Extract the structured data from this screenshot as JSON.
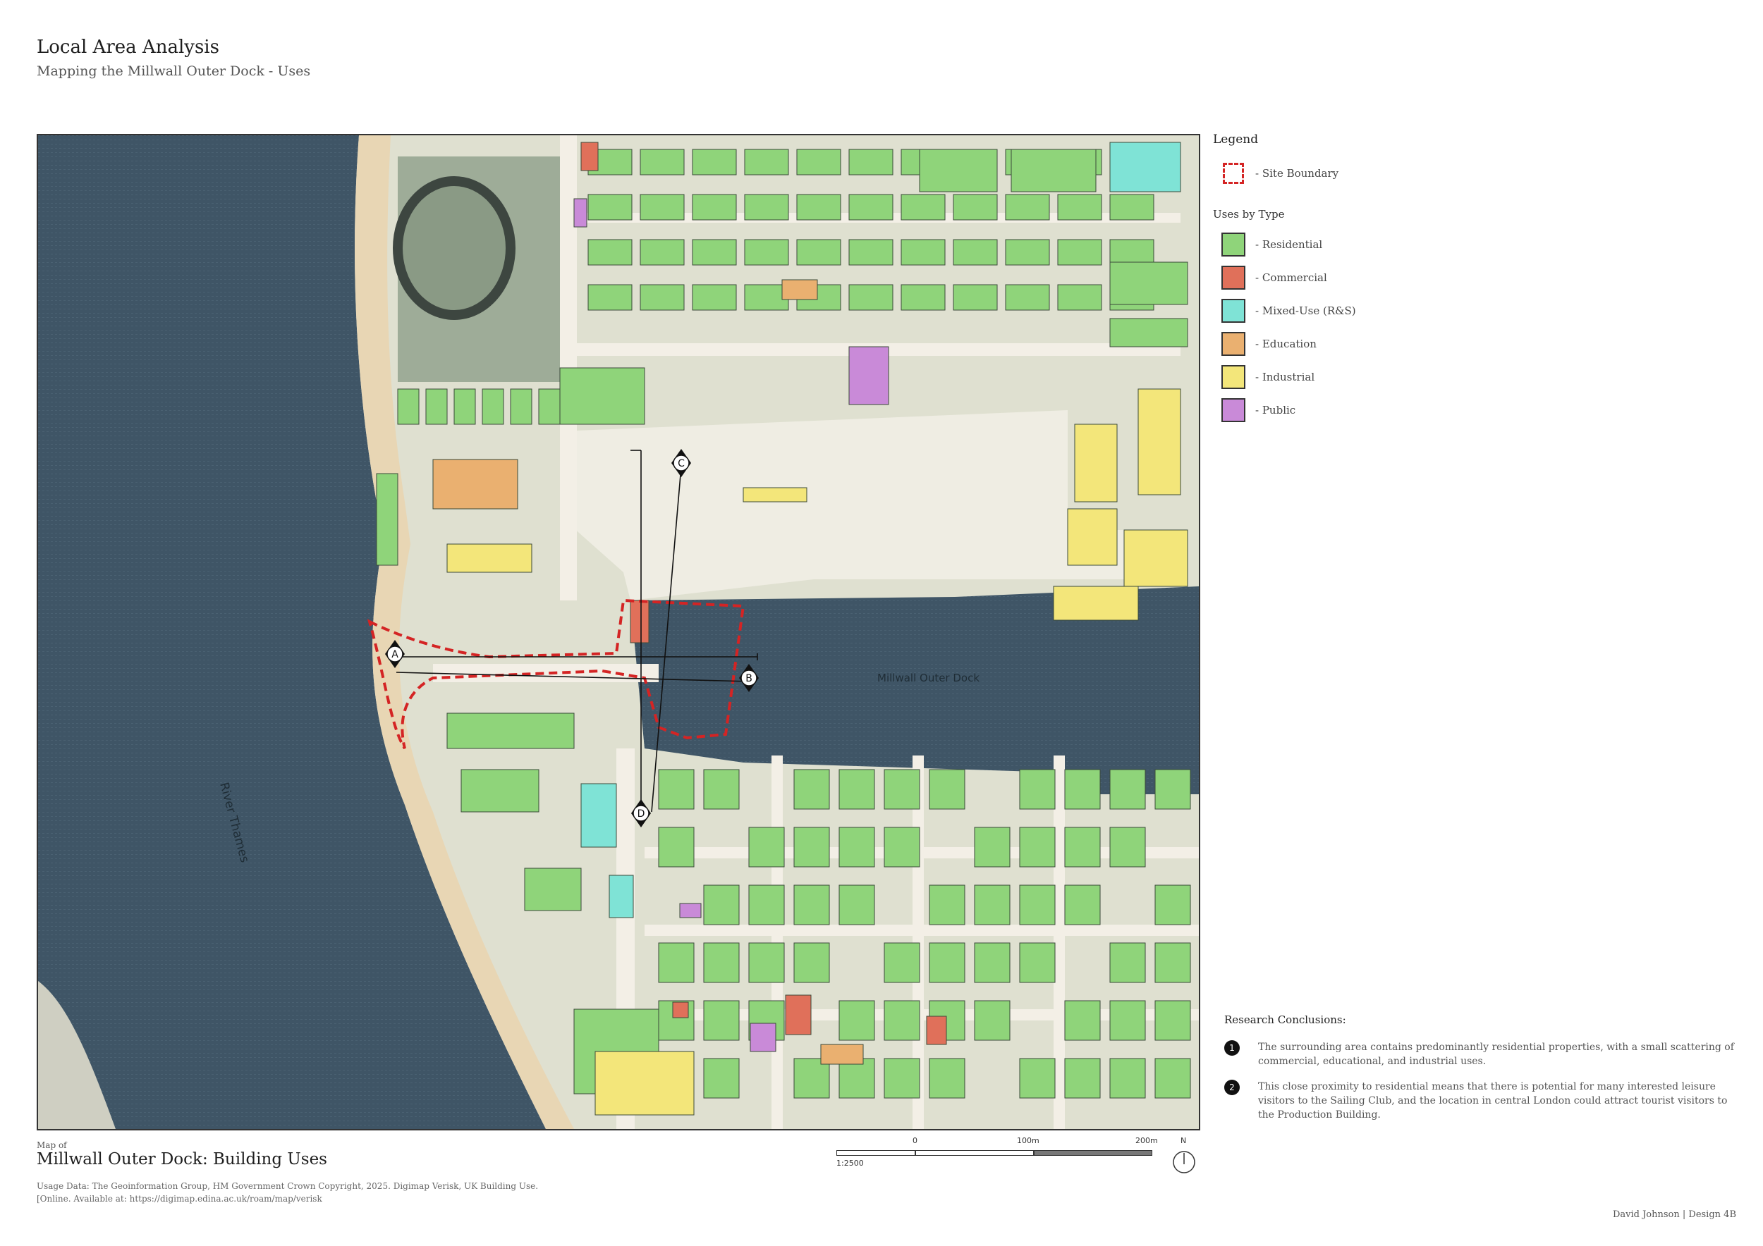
{
  "header": {
    "title": "Local Area Analysis",
    "subtitle": "Mapping the Millwall Outer Dock - Uses"
  },
  "map": {
    "labels": {
      "dock": "Millwall Outer Dock",
      "river": "River Thames",
      "marker_a": "A",
      "marker_b": "B",
      "marker_c": "C",
      "marker_d": "D"
    },
    "colors": {
      "water": "#3f5566",
      "beach": "#e8d6b4",
      "ground": "#e4e2d2",
      "park": "#9eac98",
      "road": "#f3efe6",
      "plaza": "#efede3",
      "residential": "#8fd47a",
      "commercial": "#e0705a",
      "mixed_use": "#7fe3d6",
      "education": "#eab070",
      "industrial": "#f3e67a",
      "public": "#c98ad8",
      "site_boundary": "#d42424"
    }
  },
  "legend": {
    "title": "Legend",
    "site_boundary": "- Site Boundary",
    "uses_title": "Uses by Type",
    "items": [
      {
        "label": "- Residential",
        "color": "#8fd47a"
      },
      {
        "label": "- Commercial",
        "color": "#e0705a"
      },
      {
        "label": "- Mixed-Use (R&S)",
        "color": "#7fe3d6"
      },
      {
        "label": "- Education",
        "color": "#eab070"
      },
      {
        "label": "- Industrial",
        "color": "#f3e67a"
      },
      {
        "label": "- Public",
        "color": "#c98ad8"
      }
    ]
  },
  "conclusions": {
    "title": "Research Conclusions:",
    "items": [
      {
        "num": "1",
        "text": "The surrounding area contains predominantly residential properties, with a small scattering of commercial, educational, and industrial uses."
      },
      {
        "num": "2",
        "text": "This close proximity to residential means that there is potential for many interested leisure visitors to the Sailing Club, and the location in central London could attract tourist visitors to the Production Building."
      }
    ]
  },
  "footer": {
    "map_of": "Map of",
    "map_title": "Millwall Outer Dock: Building Uses",
    "usage_line1": "Usage Data: The Geoinformation Group, HM Government Crown Copyright, 2025. Digimap Verisk, UK Building Use.",
    "usage_line2": "[Online. Available at: https://digimap.edina.ac.uk/roam/map/verisk",
    "author": "David Johnson  |  Design 4B"
  },
  "scale": {
    "ratio": "1:2500",
    "tick_0": "0",
    "tick_100": "100m",
    "tick_200": "200m",
    "north": "N"
  }
}
